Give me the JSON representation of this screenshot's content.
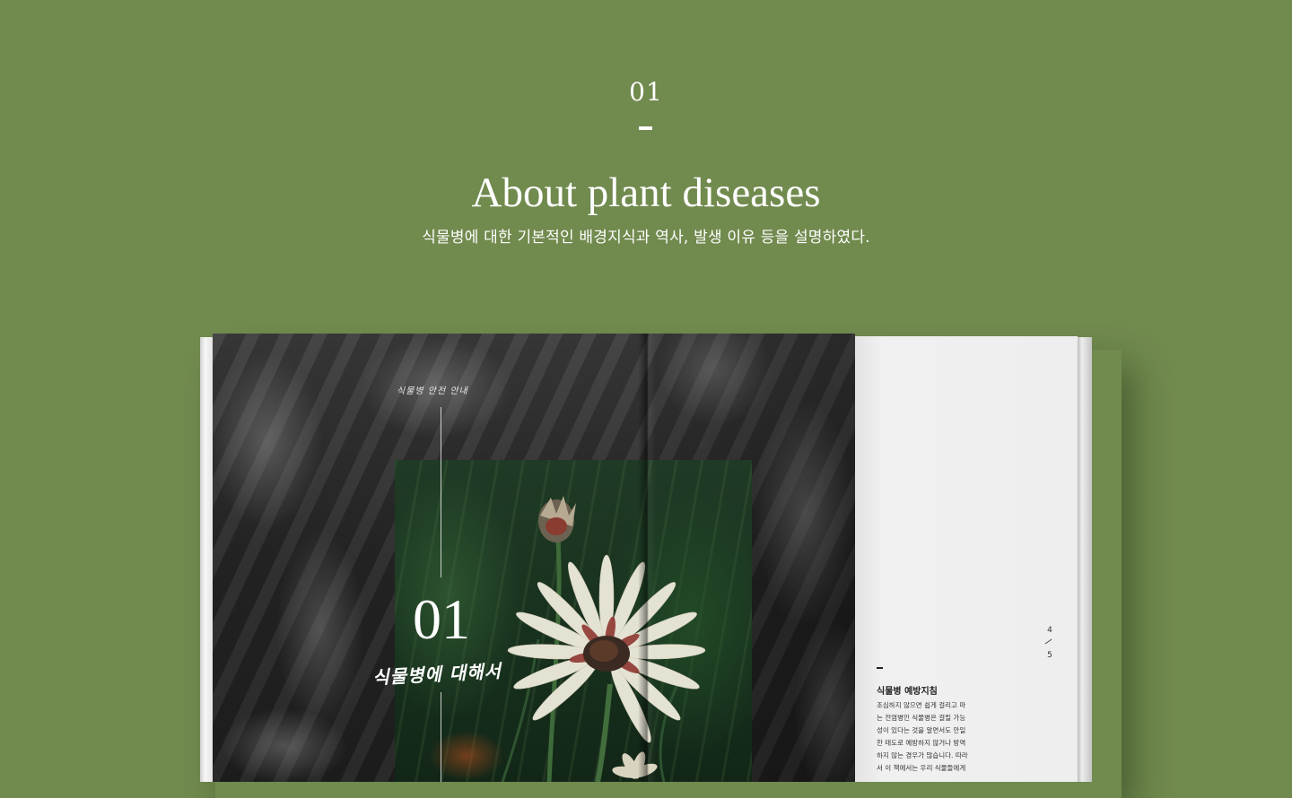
{
  "header": {
    "section_number": "01",
    "title": "About plant diseases",
    "subtitle": "식물병에 대한 기본적인 배경지식과 역사, 발생 이유 등을 설명하였다."
  },
  "book": {
    "left_page": {
      "tag": "식물병 안전 안내",
      "chapter_number": "01",
      "chapter_title": "식물병에 대해서"
    },
    "right_page": {
      "page_top": "4",
      "page_bottom": "5",
      "heading": "식물병 예방지침",
      "body_lines": [
        "조심하지 않으면 쉽게 걸리고 마",
        "는 전염병인 식물병은 걸릴 가능",
        "성이 있다는 것을 알면서도 안일",
        "한 태도로 예방하지 않거나 방역",
        "하지 않는 경우가 많습니다. 따라",
        "서 이 책에서는 우리 식물들에게"
      ]
    }
  },
  "colors": {
    "background": "#718a4e",
    "text": "#ffffff"
  }
}
